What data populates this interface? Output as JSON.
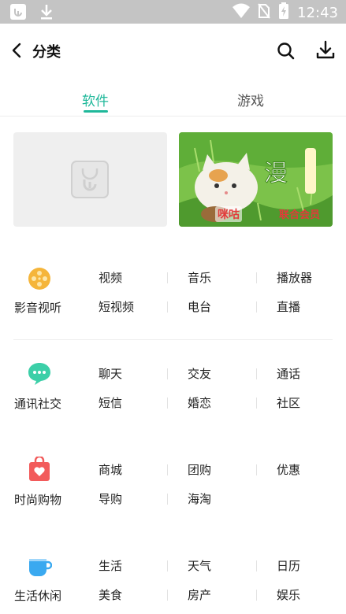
{
  "status_bar": {
    "time": "12:43",
    "left_icons": [
      "app-notification-icon",
      "download-notification-icon"
    ],
    "right_icons": [
      "wifi-icon",
      "no-sim-icon",
      "battery-charging-icon"
    ]
  },
  "header": {
    "title": "分类",
    "back_icon": "chevron-left-icon",
    "search_icon": "search-icon",
    "download_icon": "download-icon"
  },
  "tabs": [
    {
      "label": "软件",
      "active": true
    },
    {
      "label": "游戏",
      "active": false
    }
  ],
  "accent_color": "#1fb89a",
  "banners": [
    {
      "type": "placeholder",
      "icon": "app-store-placeholder-icon"
    },
    {
      "type": "image",
      "label_member": "联合会员",
      "label_brand": "咪咕"
    }
  ],
  "categories": [
    {
      "name": "影音视听",
      "icon": "film-reel-icon",
      "icon_color": "#f5b53a",
      "subcategories": [
        "视频",
        "音乐",
        "播放器",
        "短视频",
        "电台",
        "直播"
      ]
    },
    {
      "name": "通讯社交",
      "icon": "chat-bubble-icon",
      "icon_color": "#3ccfa8",
      "subcategories": [
        "聊天",
        "交友",
        "通话",
        "短信",
        "婚恋",
        "社区"
      ]
    },
    {
      "name": "时尚购物",
      "icon": "shopping-bag-icon",
      "icon_color": "#f25b5b",
      "subcategories": [
        "商城",
        "团购",
        "优惠",
        "导购",
        "海淘"
      ]
    },
    {
      "name": "生活休闲",
      "icon": "cup-icon",
      "icon_color": "#3aa9f0",
      "subcategories": [
        "生活",
        "天气",
        "日历",
        "美食",
        "房产",
        "娱乐"
      ]
    }
  ]
}
